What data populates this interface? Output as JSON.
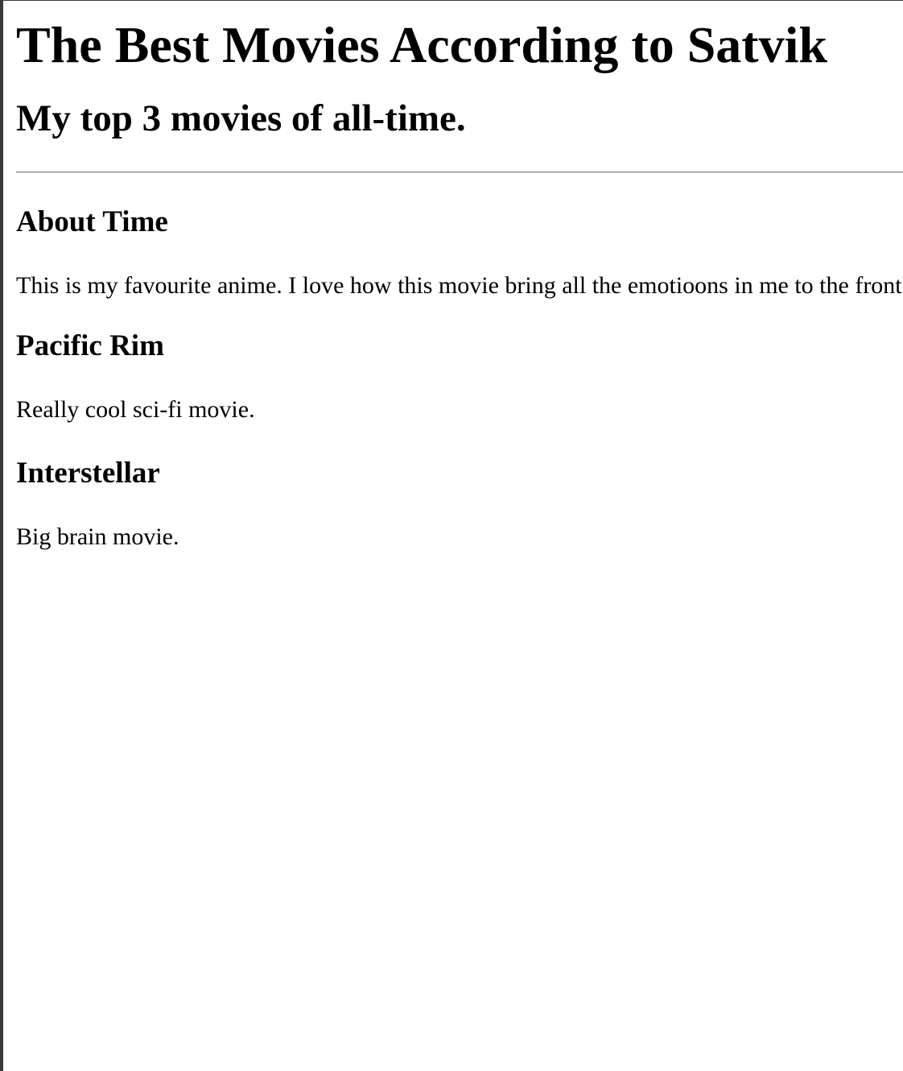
{
  "page": {
    "title": "The Best Movies According to Satvik",
    "subtitle": "My top 3 movies of all-time."
  },
  "movies": [
    {
      "title": "About Time",
      "description": "This is my favourite anime. I love how this movie bring all the emotioons in me to the front."
    },
    {
      "title": "Pacific Rim",
      "description": "Really cool sci-fi movie."
    },
    {
      "title": "Interstellar",
      "description": "Big brain movie."
    }
  ],
  "colors": {
    "background": "#ffffff",
    "text": "#000000",
    "divider": "#8a8a8a",
    "window_edge": "#3a3a3a"
  }
}
